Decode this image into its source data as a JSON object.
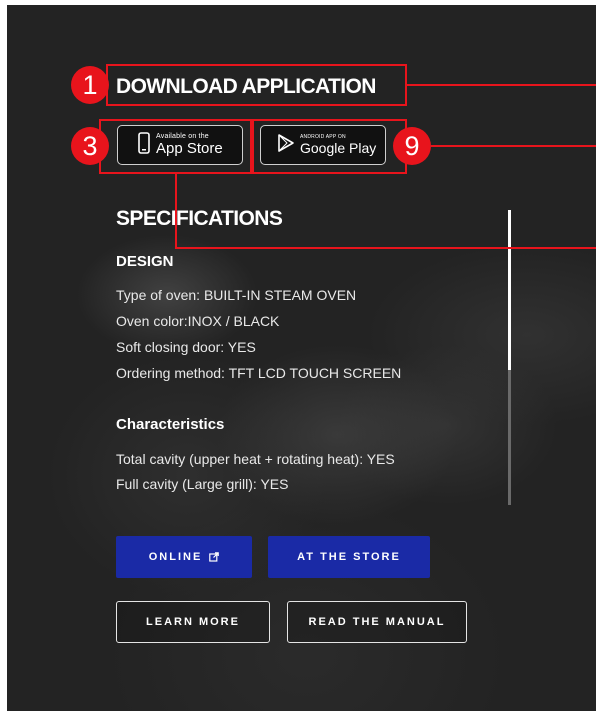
{
  "download": {
    "title": "DOWNLOAD APPLICATION"
  },
  "app_store": {
    "small": "Available on the",
    "big": "App Store"
  },
  "google_play": {
    "small": "ANDROID APP ON",
    "big": "Google Play"
  },
  "annotations": {
    "badge_1": "1",
    "badge_3": "3",
    "badge_9": "9"
  },
  "specs": {
    "title": "SPECIFICATIONS",
    "design_heading": "DESIGN",
    "design_lines": [
      "Type of oven: BUILT-IN STEAM OVEN",
      "Oven color:INOX / BLACK",
      "Soft closing door: YES",
      "Ordering method: TFT LCD TOUCH SCREEN"
    ],
    "characteristics_heading": "Characteristics",
    "characteristics_lines": [
      "Total cavity (upper heat + rotating heat): YES",
      "Full cavity (Large grill): YES"
    ]
  },
  "buttons": {
    "online": "ONLINE",
    "at_store": "AT THE STORE",
    "learn_more": "LEARN MORE",
    "read_manual": "READ THE MANUAL"
  },
  "colors": {
    "accent_red": "#e8141c",
    "button_blue": "#1a2aa6",
    "background": "#232323"
  }
}
